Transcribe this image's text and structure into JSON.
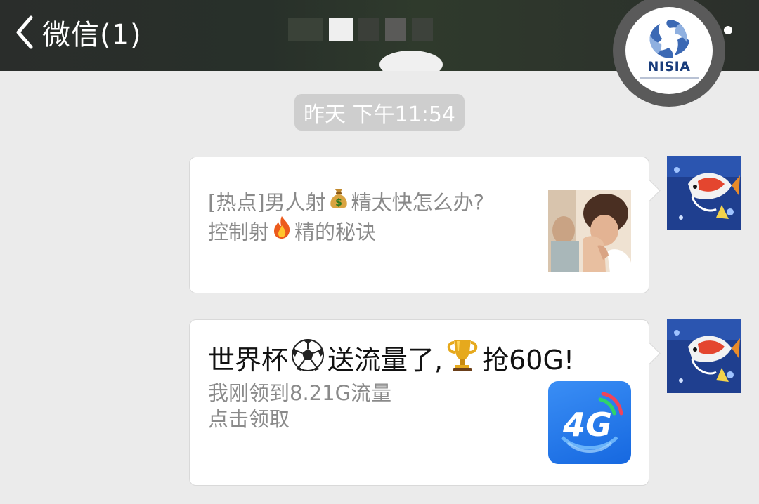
{
  "header": {
    "back_label": "微信(1)",
    "title": ""
  },
  "watermark": {
    "logo_text": "NISIA"
  },
  "chat": {
    "timestamp": "昨天 下午11:54",
    "messages": [
      {
        "type": "link-card",
        "title_line1_a": "[热点]男人射",
        "title_line1_b": "精太快怎么办?",
        "title_line2_a": "控制射",
        "title_line2_b": "精的秘诀",
        "emoji1": "money-bag-icon",
        "emoji2": "fire-icon"
      },
      {
        "type": "link-card",
        "headline_a": "世界杯",
        "headline_b": "送流量了,",
        "headline_c": "抢60G!",
        "desc_line1": "我刚领到8.21G流量",
        "desc_line2": "点击领取",
        "thumb_label": "4G"
      }
    ]
  },
  "colors": {
    "header_bg": "#2a2d2b",
    "chat_bg": "#ebebeb",
    "timestamp_bg": "#cecece",
    "card_bg": "#ffffff",
    "desc_text": "#8a8a8a",
    "thumb_4g": "#1668e0"
  }
}
